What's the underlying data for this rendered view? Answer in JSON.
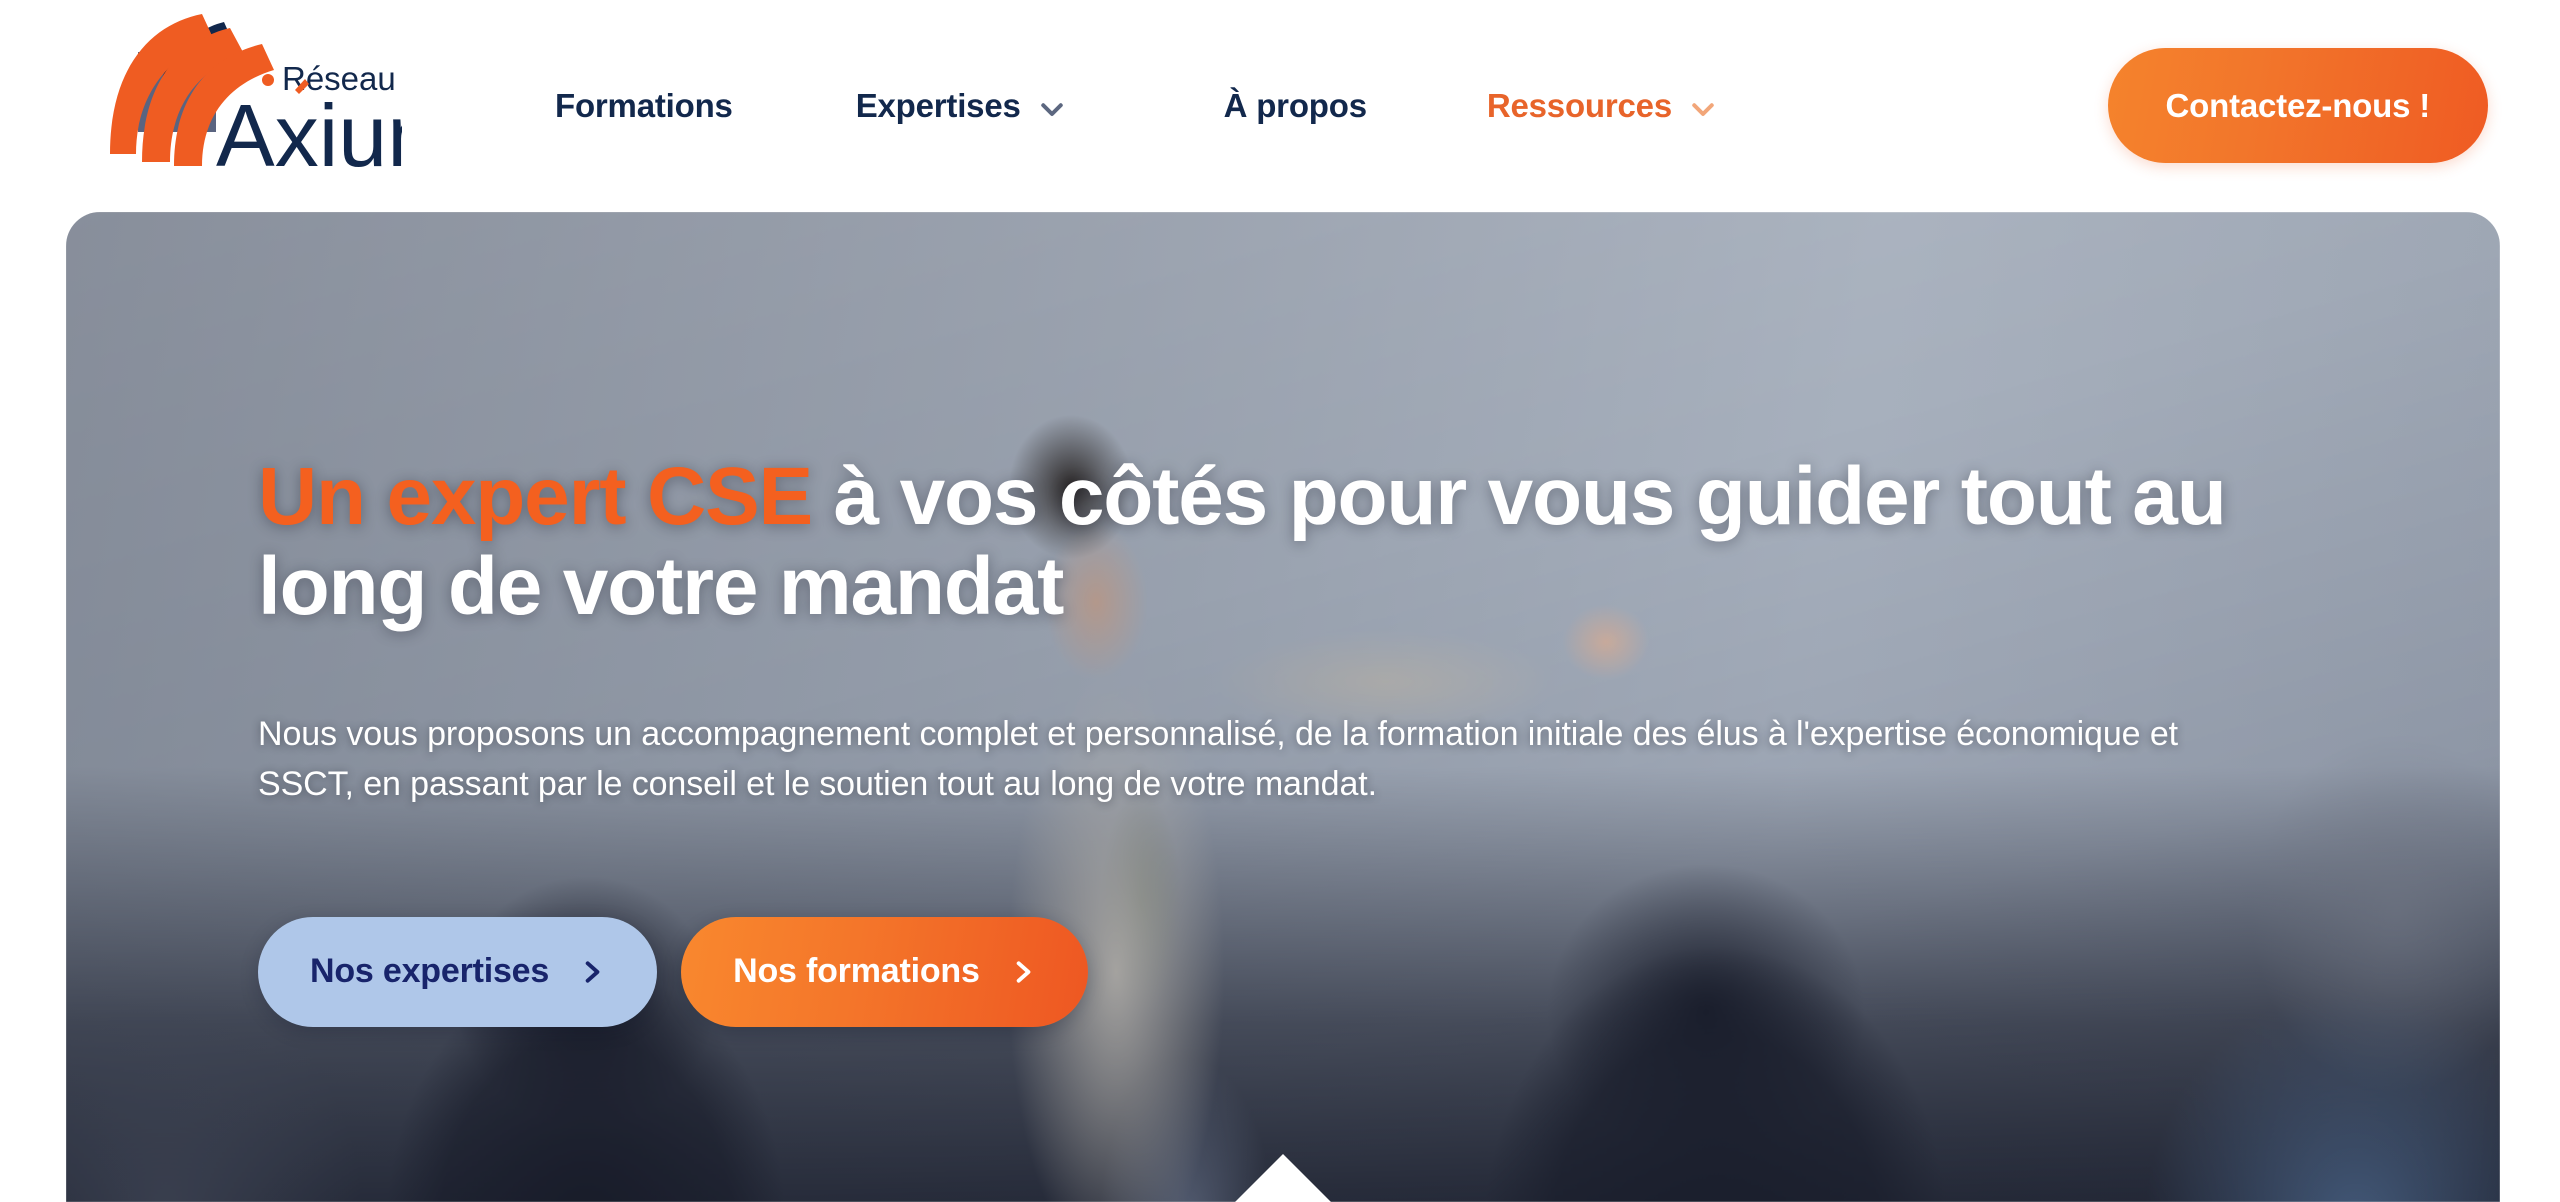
{
  "header": {
    "logo": {
      "tagline": "Réseau",
      "wordmark": "Axium",
      "alt": "Réseau Axium"
    },
    "nav": [
      {
        "label": "Formations",
        "has_dropdown": false,
        "active": false
      },
      {
        "label": "Expertises",
        "has_dropdown": true,
        "active": false
      },
      {
        "label": "À propos",
        "has_dropdown": false,
        "active": false
      },
      {
        "label": "Ressources",
        "has_dropdown": true,
        "active": true
      }
    ],
    "cta": {
      "label": "Contactez-nous !"
    }
  },
  "hero": {
    "title_accent": "Un expert CSE",
    "title_rest": " à vos côtés pour vous guider tout au long de votre mandat",
    "subtitle": "Nous vous proposons un accompagnement complet et personnalisé, de la formation initiale des élus à l'expertise économique et SSCT, en passant par le conseil et le soutien tout au long de votre mandat.",
    "buttons": [
      {
        "label": "Nos expertises",
        "style": "secondary",
        "icon": "chevron-right-icon"
      },
      {
        "label": "Nos formations",
        "style": "primary",
        "icon": "chevron-right-icon"
      }
    ]
  },
  "colors": {
    "brand_orange": "#F4601F",
    "brand_orange_light": "#F9882E",
    "brand_orange_deep": "#EE5722",
    "brand_navy": "#12284C",
    "button_blue": "#AFC7E9",
    "button_blue_text": "#18246B",
    "nav_chevron_grey": "#5C6780",
    "white": "#FFFFFF"
  }
}
